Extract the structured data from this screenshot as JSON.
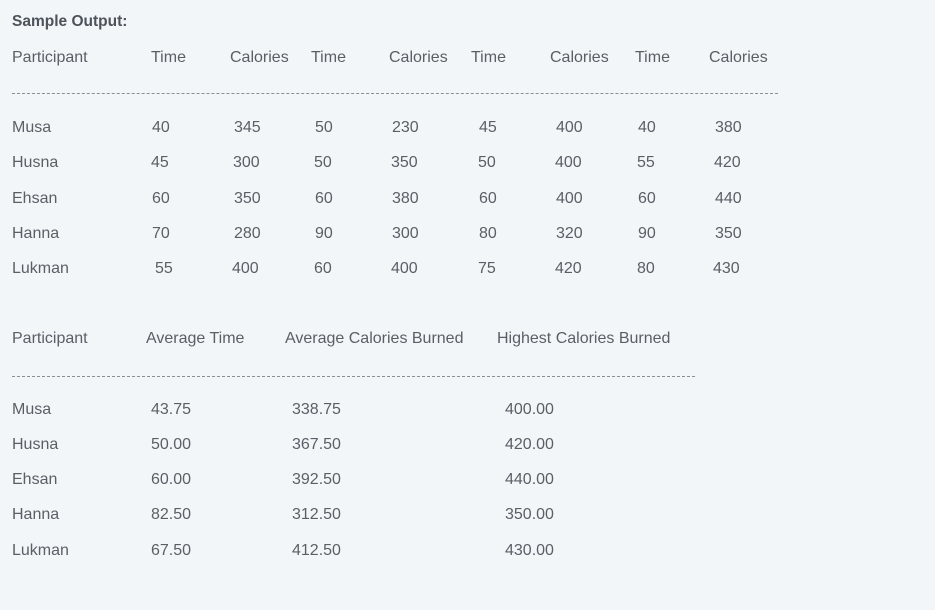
{
  "heading": "Sample Output:",
  "table1": {
    "headers": [
      "Participant",
      "Time",
      "Calories",
      "Time",
      "Calories",
      "Time",
      "Calories",
      "Time",
      "Calories"
    ],
    "rows": [
      [
        "Musa",
        "40",
        "345",
        "50",
        "230",
        "45",
        "400",
        "40",
        "380"
      ],
      [
        "Husna",
        "45",
        "300",
        "50",
        "350",
        "50",
        "400",
        "55",
        "420"
      ],
      [
        "Ehsan",
        "60",
        "350",
        "60",
        "380",
        "60",
        "400",
        "60",
        "440"
      ],
      [
        "Hanna",
        "70",
        "280",
        "90",
        "300",
        "80",
        "320",
        "90",
        "350"
      ],
      [
        "Lukman",
        "55",
        "400",
        "60",
        "400",
        "75",
        "420",
        "80",
        "430"
      ]
    ]
  },
  "table2": {
    "headers": [
      "Participant",
      "Average Time",
      "Average Calories Burned",
      "Highest Calories Burned"
    ],
    "rows": [
      [
        "Musa",
        "43.75",
        "338.75",
        "400.00"
      ],
      [
        "Husna",
        "50.00",
        "367.50",
        "420.00"
      ],
      [
        "Ehsan",
        "60.00",
        "392.50",
        "440.00"
      ],
      [
        "Hanna",
        "82.50",
        "312.50",
        "350.00"
      ],
      [
        "Lukman",
        "67.50",
        "412.50",
        "430.00"
      ]
    ]
  }
}
